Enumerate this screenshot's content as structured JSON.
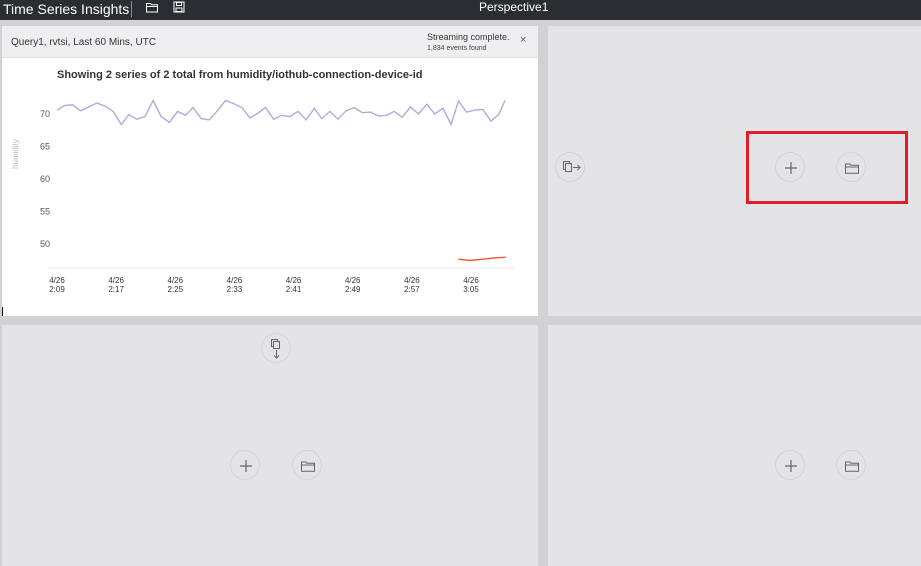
{
  "topbar": {
    "app_title": "Time Series Insights",
    "perspective_name": "Perspective1",
    "icons": [
      "open-folder-icon",
      "save-icon"
    ]
  },
  "panel1": {
    "query_info": "Query1, rvtsi, Last 60 Mins, UTC",
    "status": "Streaming complete.",
    "events_found": "1,834 events found",
    "close_symbol": "×"
  },
  "chart_data": {
    "type": "line",
    "title": "Showing 2 series of 2 total from humidity/iothub-connection-device-id",
    "xlabel": "",
    "ylabel": "humidity",
    "ylim": [
      46.5,
      74
    ],
    "yticks": [
      70,
      65,
      60,
      55,
      50
    ],
    "xticks": [
      {
        "date": "4/26",
        "time": "2:09"
      },
      {
        "date": "4/26",
        "time": "2:17"
      },
      {
        "date": "4/26",
        "time": "2:25"
      },
      {
        "date": "4/26",
        "time": "2:33"
      },
      {
        "date": "4/26",
        "time": "2:41"
      },
      {
        "date": "4/26",
        "time": "2:49"
      },
      {
        "date": "4/26",
        "time": "2:57"
      },
      {
        "date": "4/26",
        "time": "3:05"
      }
    ],
    "x_range_minutes": [
      0,
      61
    ],
    "series": [
      {
        "color": "#b7a7dc",
        "x": [
          0,
          1,
          2.1,
          3.2,
          4.3,
          5.4,
          6.5,
          7.6,
          8.7,
          9.7,
          10.8,
          11.9,
          13,
          14.1,
          15.2,
          16.3,
          17.4,
          18.4,
          19.5,
          20.6,
          21.7,
          22.8,
          23.9,
          25,
          26.1,
          27.1,
          28.2,
          29.3,
          30.4,
          31.5,
          32.6,
          33.7,
          34.8,
          35.8,
          36.9,
          38,
          39.1,
          40.2,
          41.3,
          42.4,
          43.5,
          44.6,
          45.6,
          46.7,
          47.8,
          48.9,
          50,
          51.1,
          52.2,
          53.3,
          54.3,
          55.4,
          56.5,
          57.6,
          58.7,
          59.8,
          60.6
        ],
        "y": [
          70.6,
          71.3,
          71.4,
          70.5,
          71.1,
          71.7,
          71.2,
          70.4,
          68.4,
          69.9,
          69.2,
          69.6,
          72.1,
          69.6,
          68.7,
          70.4,
          69.8,
          71.0,
          69.3,
          69.1,
          70.5,
          72.1,
          71.6,
          71.0,
          69.4,
          70.1,
          71.0,
          69.2,
          69.8,
          69.6,
          70.4,
          69.1,
          70.9,
          69.3,
          70.4,
          69.2,
          70.5,
          71.0,
          70.2,
          70.3,
          69.7,
          69.8,
          70.4,
          69.5,
          71.1,
          70.0,
          71.5,
          70.0,
          70.9,
          68.4,
          72.0,
          70.3,
          70.6,
          70.7,
          68.9,
          70.0,
          72.1
        ]
      },
      {
        "color": "#e8593a",
        "x": [
          54.3,
          55.8,
          57.6,
          59.2,
          60.7
        ],
        "y": [
          47.7,
          47.5,
          47.7,
          47.9,
          48.0
        ]
      }
    ]
  },
  "empty_panels": {
    "add_symbol": "+",
    "icons": [
      "add-icon",
      "open-folder-icon",
      "duplicate-right-icon",
      "duplicate-down-icon"
    ]
  }
}
